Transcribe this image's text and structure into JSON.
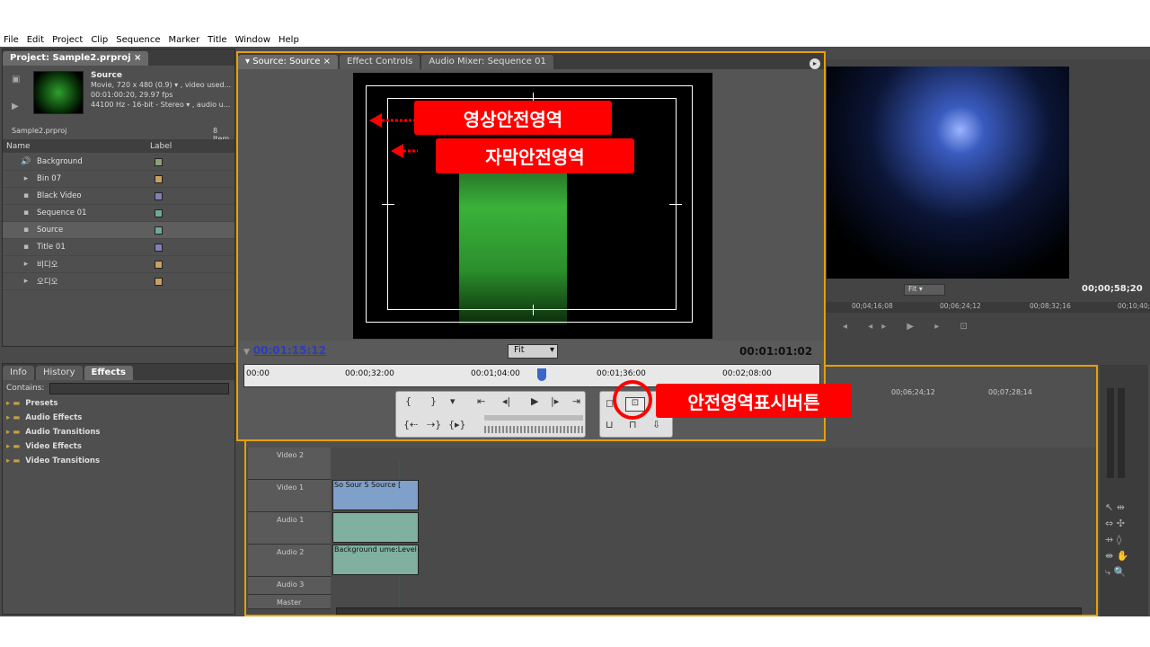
{
  "menu": [
    "File",
    "Edit",
    "Project",
    "Clip",
    "Sequence",
    "Marker",
    "Title",
    "Window",
    "Help"
  ],
  "project": {
    "tab": "Project: Sample2.prproj",
    "clip_name": "Source",
    "clip_info1": "Movie, 720 x 480 (0.9)  ▾ , video used...",
    "clip_info2": "00:01:00:20, 29.97 fps",
    "clip_info3": "44100 Hz - 16-bit - Stereo  ▾ , audio u...",
    "file": "Sample2.prproj",
    "count": "8 Item",
    "col_name": "Name",
    "col_label": "Label",
    "items": [
      {
        "icon": "🔊",
        "name": "Background",
        "color": "#8aa07a"
      },
      {
        "icon": "▸",
        "name": "Bin 07",
        "color": "#c8a060"
      },
      {
        "icon": "▪",
        "name": "Black Video",
        "color": "#8080b8"
      },
      {
        "icon": "▪",
        "name": "Sequence 01",
        "color": "#70a890"
      },
      {
        "icon": "▪",
        "name": "Source",
        "color": "#70a8a0"
      },
      {
        "icon": "▪",
        "name": "Title 01",
        "color": "#8080b8"
      },
      {
        "icon": "▸",
        "name": "비디오",
        "color": "#c8a060"
      },
      {
        "icon": "▸",
        "name": "오디오",
        "color": "#c8a060"
      }
    ]
  },
  "effects": {
    "tabs": [
      "Info",
      "History",
      "Effects"
    ],
    "contains": "Contains:",
    "folders": [
      "Presets",
      "Audio Effects",
      "Audio Transitions",
      "Video Effects",
      "Video Transitions"
    ]
  },
  "source": {
    "tabs": [
      "Source: Source",
      "Effect Controls",
      "Audio Mixer: Sequence 01"
    ],
    "timecode_left": "00:01:15:12",
    "fit": "Fit",
    "timecode_right": "00:01:01:02",
    "ruler": [
      "00:00",
      "00:00;32:00",
      "00:01;04:00",
      "00:01;36:00",
      "00:02;08:00"
    ]
  },
  "program": {
    "fit": "Fit",
    "timecode": "00;00;58;20",
    "ruler": [
      "00;04;16;08",
      "00;06;24;12",
      "00;08;32;16",
      "00;10;40;"
    ]
  },
  "timeline": {
    "ruler": [
      "00;06;24;12",
      "00;07;28;14"
    ],
    "tracks": [
      "Video 2",
      "Video 1",
      "Audio 1",
      "Audio 2",
      "Audio 3",
      "Master"
    ],
    "clip_labels": [
      "So",
      "Sour",
      "S",
      "Source [",
      "Background",
      "ume:Level ▾"
    ]
  },
  "callouts": {
    "action_safe": "영상안전영역",
    "title_safe": "자막안전영역",
    "safe_button": "안전영역표시버튼"
  },
  "colors": {
    "callout": "#ff0000",
    "accent": "#e8a000",
    "timecode_blue": "#2a3dbf"
  }
}
